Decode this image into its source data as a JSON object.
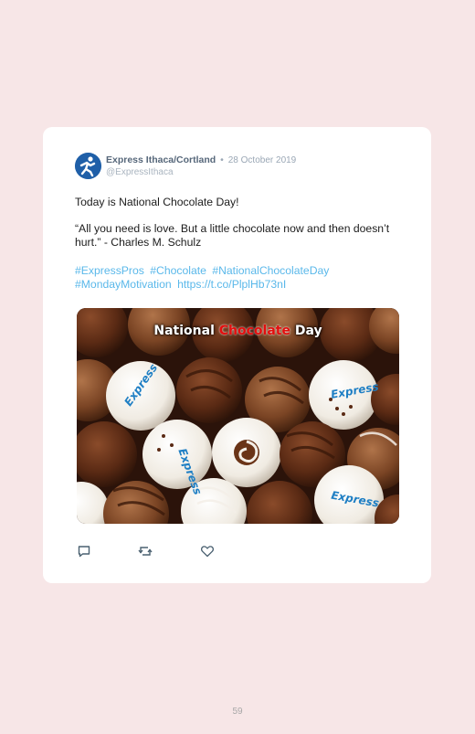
{
  "tweet": {
    "author_name": "Express Ithaca/Cortland",
    "separator": "•",
    "date": "28 October 2019",
    "handle": "@ExpressIthaca",
    "text_line1": "Today is National Chocolate Day!",
    "text_line2": "“All you need is love. But a little chocolate now and then doesn’t hurt.” - Charles M. Schulz",
    "hashtags": [
      "#ExpressPros",
      "#Chocolate",
      "#NationalChocolateDay",
      "#MondayMotivation"
    ],
    "link": "https://t.co/PlplHb73nI",
    "media": {
      "title_part1": "National ",
      "title_part2": "Chocolate",
      "title_part3": " Day",
      "brand_label": "Express"
    }
  },
  "actions": {
    "reply_icon": "reply-icon",
    "retweet_icon": "retweet-icon",
    "like_icon": "like-icon"
  },
  "page_number": "59",
  "colors": {
    "background": "#f7e6e7",
    "hashtag": "#5ab8ea",
    "title_highlight": "#e30e0e",
    "brand_blue": "#1f5fa8"
  }
}
